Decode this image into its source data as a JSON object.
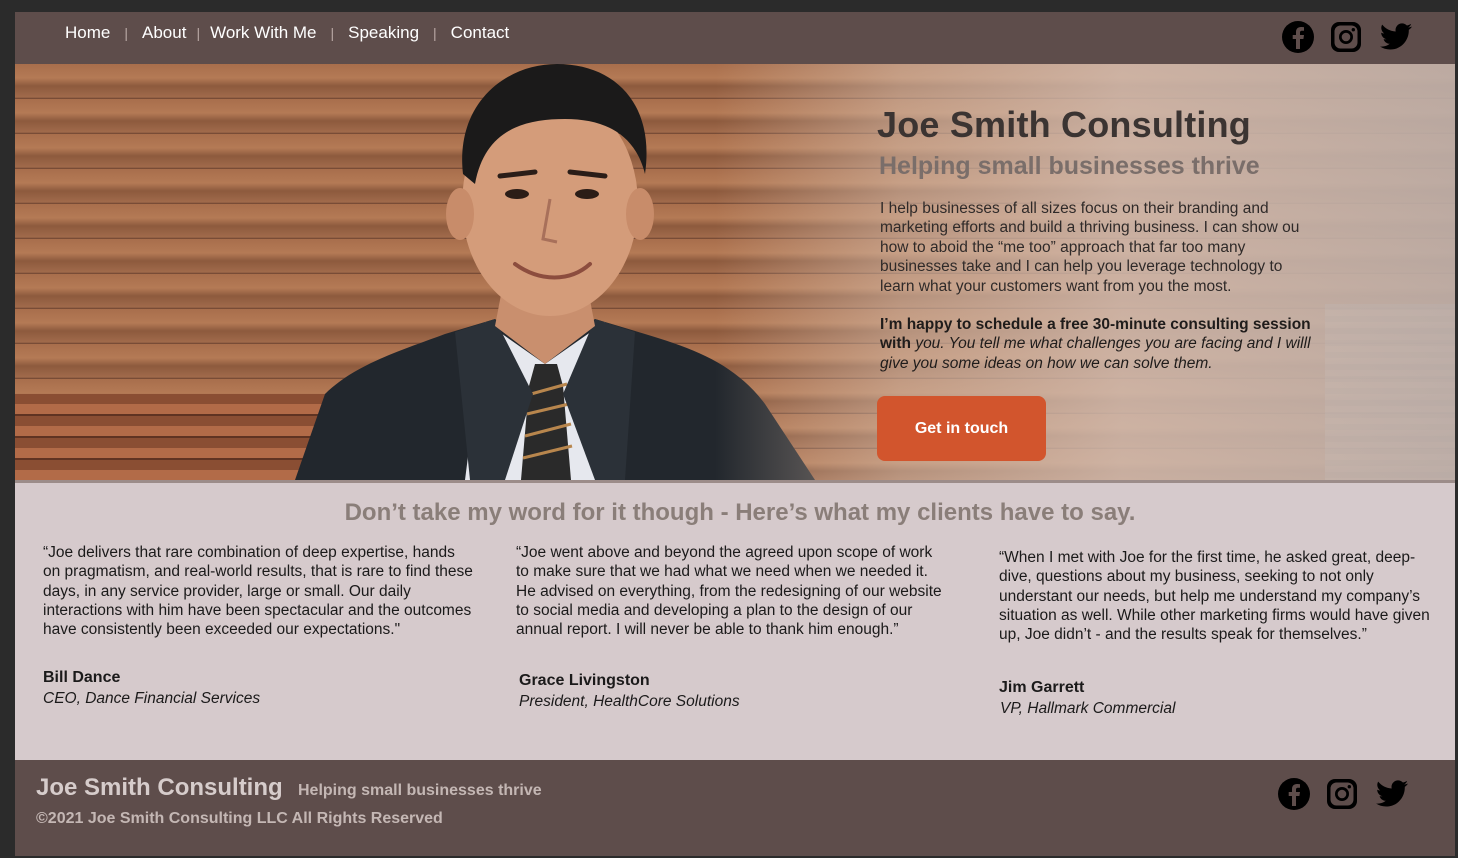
{
  "nav": {
    "items": [
      {
        "label": "Home"
      },
      {
        "label": "About"
      },
      {
        "label": "Work With Me"
      },
      {
        "label": "Speaking"
      },
      {
        "label": "Contact"
      }
    ]
  },
  "social": {
    "icons": [
      "facebook-icon",
      "instagram-icon",
      "twitter-icon"
    ],
    "icon_color": "#000000"
  },
  "hero": {
    "title": "Joe Smith Consulting",
    "subtitle": "Helping small businesses thrive",
    "body": "I help businesses of all sizes focus on their branding and marketing efforts and build a thriving business. I can show ou how to aboid the “me too” approach that far too many businesses take and I can help you leverage technology to learn what your customers want from you the most.",
    "cta_bold": "I’m happy to schedule a free 30-minute consulting session with",
    "cta_italic": "you. You tell me what challenges you are facing and I willl give you some ideas on how we can solve them.",
    "button_label": "Get in touch",
    "button_color": "#d2552d"
  },
  "testimonials": {
    "heading": "Don’t take my word for it though - Here’s what my clients have to say.",
    "items": [
      {
        "quote": "“Joe delivers that rare combination of deep expertise, hands on pragmatism, and real-world results, that is rare to find these days, in any service provider, large or small. Our daily interactions with him have been spectacular and the outcomes have consistently been exceeded our expectations.\"",
        "name": "Bill Dance",
        "role": "CEO, Dance Financial Services"
      },
      {
        "quote": "“Joe went above and beyond the agreed upon scope of work to make sure that we had what we need when we needed it. He advised on everything, from the redesigning of our website to social media and developing a plan to the design of our annual report. I will never be able to thank him enough.”",
        "name": "Grace Livingston",
        "role": "President, HealthCore Solutions"
      },
      {
        "quote": "“When I met with Joe for the first time, he asked great, deep-dive, questions about my business, seeking to not only understant our needs, but help me understand my company’s situation as well. While other marketing firms would have given up, Joe didn’t -  and the results speak for themselves.”",
        "name": "Jim Garrett",
        "role": "VP, Hallmark Commercial"
      }
    ]
  },
  "footer": {
    "title": "Joe Smith Consulting",
    "subtitle": "Helping small businesses thrive",
    "copyright": "©2021 Joe Smith Consulting LLC All Rights Reserved"
  },
  "colors": {
    "bar": "#5e4d4b",
    "testimonial_bg": "#d6cacc",
    "accent": "#d2552d"
  }
}
